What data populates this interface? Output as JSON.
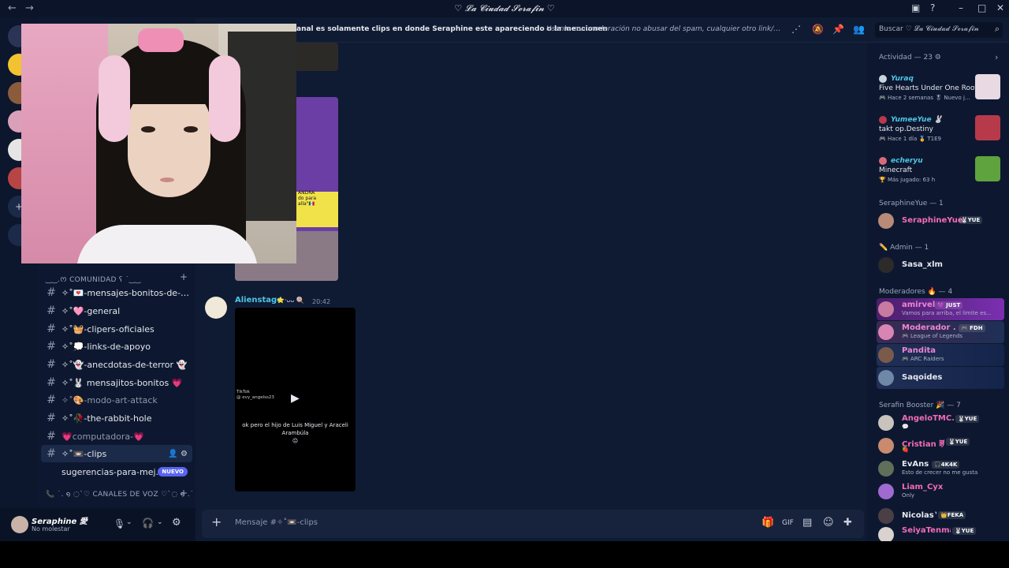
{
  "window": {
    "title": "♡ 𝓛𝓪 𝓒𝓲𝓾𝓭𝓪𝓭 𝓢𝓮𝓻𝓪𝓯𝓲𝓷 ♡",
    "back_icon": "arrow-left-icon",
    "forward_icon": "arrow-right-icon",
    "controls": [
      "inbox-icon",
      "help-icon",
      "minimize-icon",
      "maximize-icon",
      "close-icon"
    ]
  },
  "header": {
    "topic_name": "anal es solamente clips en donde Seraphine este apareciendo o la mencionen",
    "topic_description": "Úsenlo con moderación no abusar del spam, cualquier otro link/post que ...",
    "icons": [
      "threads-icon",
      "mute-icon",
      "pin-icon",
      "members-icon"
    ],
    "search_placeholder": "Buscar ♡ 𝓛𝓪 𝓒𝓲𝓾𝓭𝓪𝓭 𝓢𝓮𝓻𝓪𝓯𝓲𝓷"
  },
  "sidebar": {
    "category_comunidad": "‿‿.ᰔ COMUNIDAD ʕ ˙‿‿",
    "category_voz": "📞 ˙. ໑ ◌ˋ♡ CANALES DE VOZ ♡ˋ◌ ໑ .˙",
    "channels": [
      {
        "label": "✧˚💌-mensajes-bonitos-de-cu...",
        "muted": false,
        "unread": false
      },
      {
        "label": "✧˚🩷-general",
        "muted": false,
        "unread": true
      },
      {
        "label": "✧˚🧺-clipers-oficiales",
        "muted": false,
        "unread": true
      },
      {
        "label": "✧˚💭-links-de-apoyo",
        "muted": false,
        "unread": true
      },
      {
        "label": "✧˚👻-anecdotas-de-terror 👻",
        "muted": false,
        "unread": true
      },
      {
        "label": "✧˚🐰 mensajitos-bonitos 💗",
        "muted": false,
        "unread": true
      },
      {
        "label": "✧˚🎨-modo-art-attack",
        "muted": true,
        "unread": false
      },
      {
        "label": "✧˚🥀-the-rabbit-hole",
        "muted": false,
        "unread": true
      },
      {
        "label": "💗computadora-💗",
        "muted": true,
        "unread": false
      },
      {
        "label": "✧˚📼-clips",
        "muted": false,
        "unread": false,
        "active": true
      },
      {
        "label": "sugerencias-para-mej...",
        "muted": false,
        "unread": true,
        "badge": "NUEVO"
      }
    ]
  },
  "user_panel": {
    "name": "Seraphine 愛",
    "status": "No molestar",
    "icons": [
      "microphone-icon",
      "headphones-icon",
      "settings-icon"
    ]
  },
  "chat": {
    "message": {
      "author": "Alienstage",
      "author_badges": "⭐·ᴗᴗ 🍭",
      "time": "20:42",
      "video_caption": "ok pero el hijo de Luis Miguel y Araceli Arambúla",
      "video_emoji": "😐",
      "video_watermark": "TikTok\n@ evy_angelss23"
    },
    "embed_text_1": "ANDRA\ndo para\nalla\"🇲🇽"
  },
  "composer": {
    "placeholder": "Mensaje #✧˚📼-clips",
    "icons": [
      "gift-icon",
      "gif-icon",
      "sticker-icon",
      "emoji-icon",
      "apps-icon"
    ]
  },
  "members": {
    "activity_header": "Actividad — 23 ⚙",
    "activities": [
      {
        "user": "Yuraq",
        "game": "Five Hearts Under One Roof",
        "meta": "🎮 Hace 2 semanas  🎖 Nuevo j...",
        "thumb_color": "#e8d9e3"
      },
      {
        "user": "YumeeYue 🐰",
        "game": "takt op.Destiny",
        "meta": "🎮 Hace 1 día  🏅 T1E9",
        "thumb_color": "#b73a4a"
      },
      {
        "user": "echeryu",
        "game": "Minecraft",
        "meta": "🏆 Más jugado: 63 h",
        "thumb_color": "#5fa33e"
      }
    ],
    "groups": [
      {
        "title": "SeraphineYue — 1",
        "members": [
          {
            "name": "SeraphineYue",
            "tag": "🐰YUE",
            "sub": "",
            "color": "#f26bb7"
          }
        ]
      },
      {
        "title": "✏️ Admin — 1",
        "members": [
          {
            "name": "Sasa_xlm",
            "tag": "",
            "sub": "",
            "color": "#e6e8ee"
          }
        ]
      },
      {
        "title": "Moderadores 🔥 — 4",
        "members": [
          {
            "name": "amirvel",
            "tag": "💜 JUST",
            "sub": "Vamos para arriba, el limite es...",
            "color": "#ee86d2"
          },
          {
            "name": "Moderador ...",
            "tag": "🎮 FDH",
            "sub": "🎮 League of Legends",
            "color": "#ee86d2"
          },
          {
            "name": "Pandita",
            "tag": "",
            "sub": "🎮 ARC Raiders",
            "color": "#ee86d2"
          },
          {
            "name": "Saqoides",
            "tag": "",
            "sub": "",
            "color": "#e6e8ee"
          }
        ]
      },
      {
        "title": "Serafin Booster 🎉 — 7",
        "members": [
          {
            "name": "AngeloTMC...",
            "tag": "🐰YUE",
            "sub": "💬",
            "color": "#f26bb7"
          },
          {
            "name": "Cristian 暁",
            "tag": "🐰YUE",
            "sub": "🍓",
            "color": "#f26bb7"
          },
          {
            "name": "EvAns",
            "tag": "🎧4K4K",
            "sub": "Esto de crecer no me gusta",
            "color": "#e6e8ee"
          },
          {
            "name": "Liam_Cyx",
            "tag": "",
            "sub": "Only",
            "color": "#f26bb7"
          },
          {
            "name": "Nicolas™",
            "tag": "👑FEKA",
            "sub": "",
            "color": "#e6e8ee"
          },
          {
            "name": "SeiyaTenma",
            "tag": "🐰YUE",
            "sub": "",
            "color": "#f26bb7"
          }
        ]
      }
    ]
  },
  "webcam": {
    "label": "webcam overlay"
  }
}
